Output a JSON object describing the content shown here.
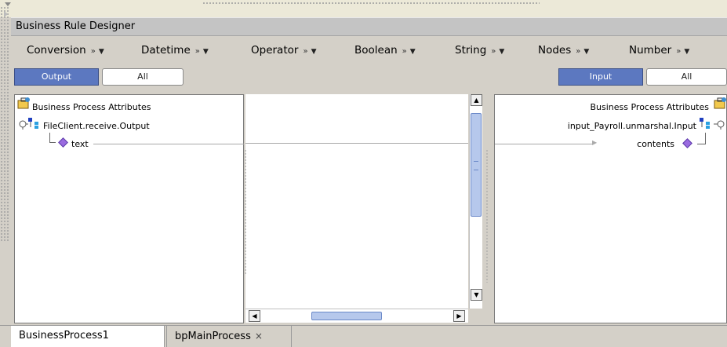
{
  "title": "Business Rule Designer",
  "menu": [
    {
      "label": "Conversion"
    },
    {
      "label": "Datetime"
    },
    {
      "label": "Operator"
    },
    {
      "label": "Boolean"
    },
    {
      "label": "String"
    },
    {
      "label": "Nodes"
    },
    {
      "label": "Number"
    }
  ],
  "menu_glyph": "»",
  "left_toggle": {
    "output_label": "Output",
    "all_label": "All",
    "selected": "Output"
  },
  "right_toggle": {
    "input_label": "Input",
    "all_label": "All",
    "selected": "Input"
  },
  "left_tree": {
    "root_label": "Business Process Attributes",
    "node_label": "FileClient.receive.Output",
    "leaf_label": "text"
  },
  "right_tree": {
    "root_label": "Business Process Attributes",
    "node_label": "input_Payroll.unmarshal.Input",
    "leaf_label": "contents"
  },
  "tabs": [
    {
      "label": "BusinessProcess1",
      "active": true
    },
    {
      "label": "bpMainProcess",
      "active": false,
      "closable": true
    }
  ],
  "close_glyph": "×",
  "colors": {
    "toggle_selected": "#5c78c0",
    "leaf_diamond": "#9a6be0",
    "scroll_thumb": "#b6c8ec"
  }
}
